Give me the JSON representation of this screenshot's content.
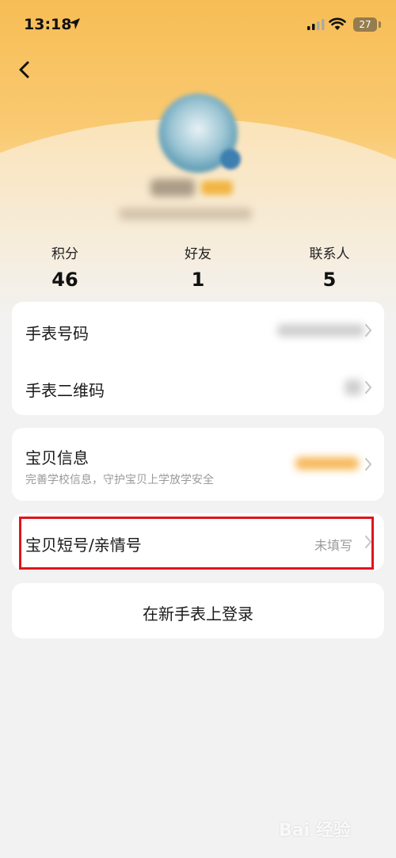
{
  "status_bar": {
    "time": "13:18",
    "battery": "27"
  },
  "stats": [
    {
      "label": "积分",
      "value": "46"
    },
    {
      "label": "好友",
      "value": "1"
    },
    {
      "label": "联系人",
      "value": "5"
    }
  ],
  "watch_card": {
    "watch_number_label": "手表号码",
    "watch_qrcode_label": "手表二维码"
  },
  "baby_card": {
    "info_label": "宝贝信息",
    "info_subtitle": "完善学校信息，守护宝贝上学放学安全"
  },
  "short_number": {
    "label": "宝贝短号/亲情号",
    "value": "未填写"
  },
  "login_new_watch": {
    "label": "在新手表上登录"
  },
  "watermark": "Bai 经验",
  "colors": {
    "header_gradient_top": "#f7bd55",
    "highlight_border": "#e0141c",
    "card_bg": "#ffffff",
    "page_bg": "#f2f2f2"
  }
}
